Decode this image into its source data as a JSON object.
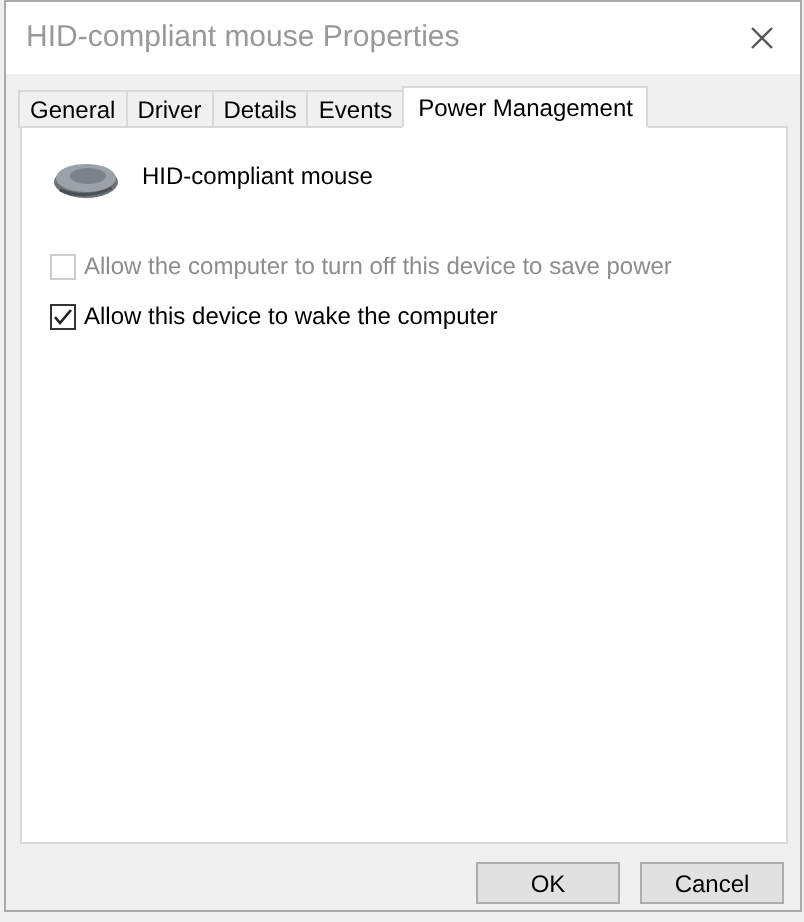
{
  "window": {
    "title": "HID-compliant mouse Properties"
  },
  "tabs": [
    {
      "label": "General",
      "selected": false
    },
    {
      "label": "Driver",
      "selected": false
    },
    {
      "label": "Details",
      "selected": false
    },
    {
      "label": "Events",
      "selected": false
    },
    {
      "label": "Power Management",
      "selected": true
    }
  ],
  "device": {
    "name": "HID-compliant mouse"
  },
  "options": [
    {
      "label": "Allow the computer to turn off this device to save power",
      "checked": false,
      "disabled": true
    },
    {
      "label": "Allow this device to wake the computer",
      "checked": true,
      "disabled": false
    }
  ],
  "buttons": [
    "OK",
    "Cancel"
  ]
}
